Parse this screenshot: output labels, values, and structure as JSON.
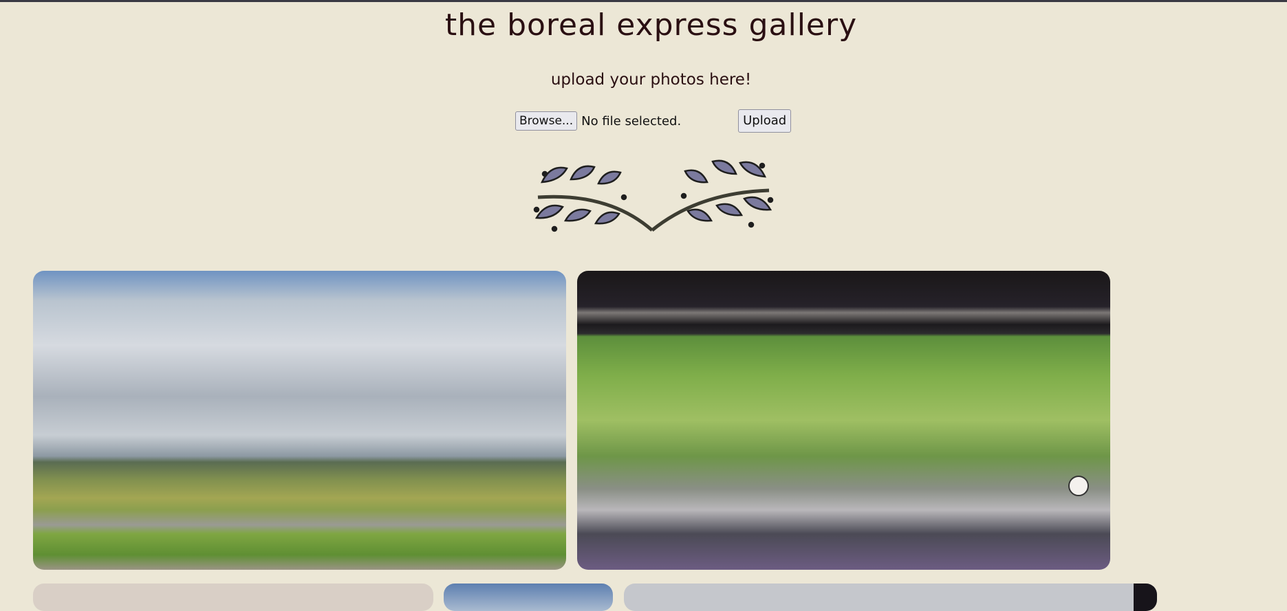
{
  "header": {
    "title": "the boreal express gallery",
    "subtitle": "upload your photos here!"
  },
  "upload_form": {
    "browse_label": "Browse...",
    "file_status": "No file selected.",
    "upload_label": "Upload"
  },
  "decoration": {
    "icon": "laurel-branch-icon"
  },
  "gallery": {
    "photos": [
      {
        "name": "photo-field-landscape",
        "desc_hidden": true
      },
      {
        "name": "photo-train-window",
        "desc_hidden": true
      },
      {
        "name": "photo-partial-3",
        "desc_hidden": true
      },
      {
        "name": "photo-partial-4",
        "desc_hidden": true
      },
      {
        "name": "photo-partial-5",
        "desc_hidden": true
      }
    ]
  },
  "colors": {
    "background": "#ece7d6",
    "text": "#2a0f12",
    "laurel_leaf": "#7b7a9e"
  }
}
